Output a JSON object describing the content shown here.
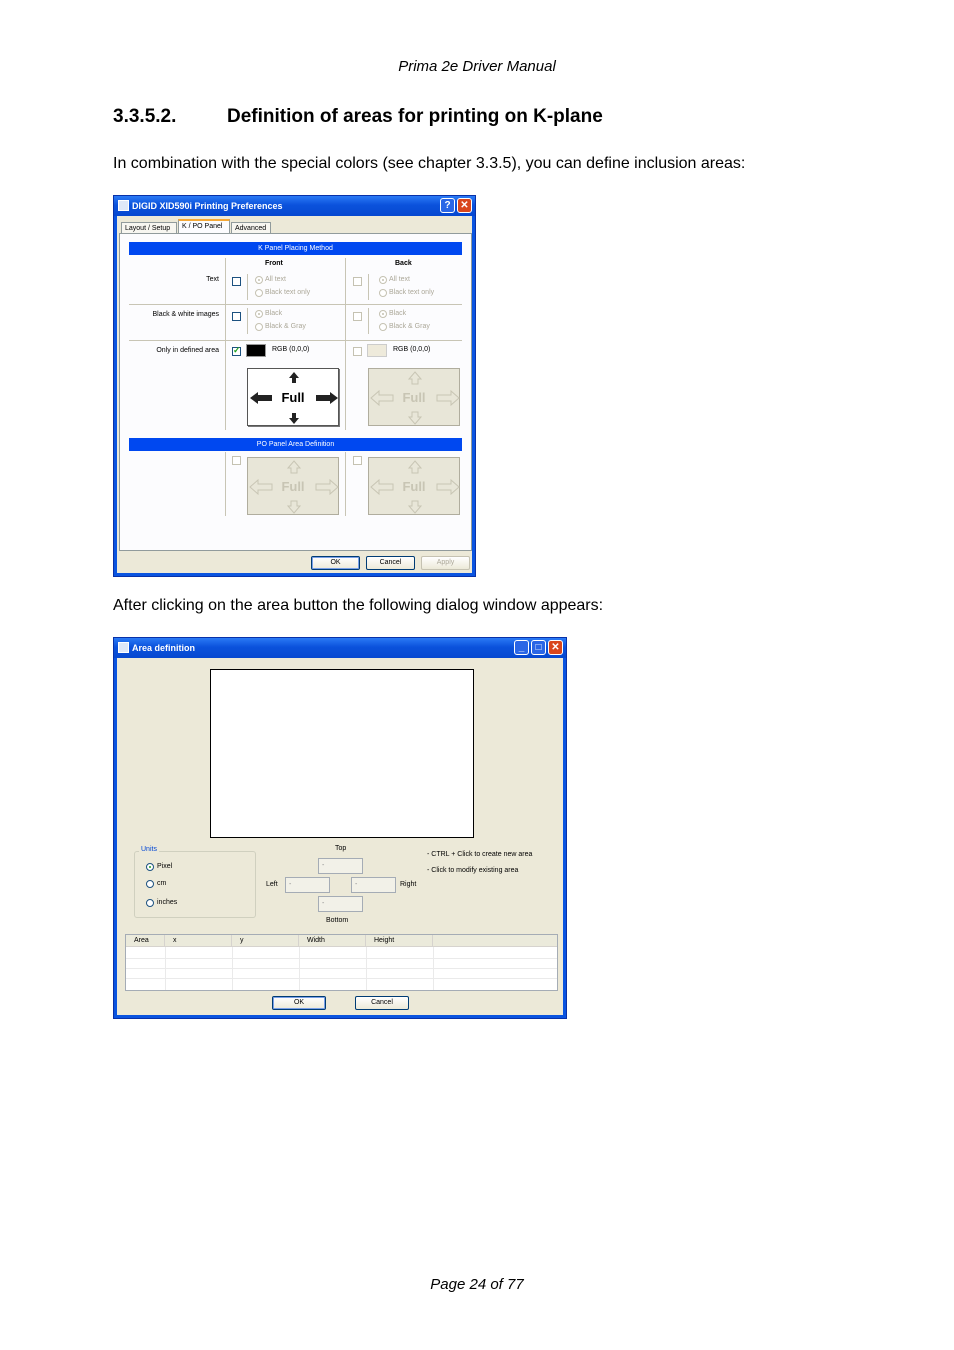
{
  "header": {
    "title": "Prima 2e Driver Manual"
  },
  "section": {
    "number": "3.3.5.2.",
    "title": "Definition of areas for printing on K-plane"
  },
  "intro": "In combination with the special colors (see chapter 3.3.5), you can define inclusion areas:",
  "between": "After clicking on the area button the following dialog window appears:",
  "footer": {
    "page": "Page 24 of 77"
  },
  "prefs": {
    "title": "DIGID XID590i Printing Preferences",
    "help": "?",
    "close": "✕",
    "tabs": [
      "Layout / Setup",
      "K / PO Panel",
      "Advanced"
    ],
    "k_panel_header": "K Panel Placing Method",
    "front": "Front",
    "back": "Back",
    "rows": {
      "text": "Text",
      "bw_images": "Black & white images",
      "defined_area": "Only in defined area"
    },
    "all_text": "All text",
    "black_text_only": "Black text only",
    "black": "Black",
    "black_gray": "Black & Gray",
    "rgb": "RGB (0,0,0)",
    "full": "Full",
    "po_header": "PO Panel Area Definition",
    "ok": "OK",
    "cancel": "Cancel",
    "apply": "Apply"
  },
  "area": {
    "title": "Area definition",
    "minimize": "_",
    "maximize": "□",
    "close": "✕",
    "units_label": "Units",
    "units": [
      "Pixel",
      "cm",
      "inches"
    ],
    "top": "Top",
    "left": "Left",
    "right": "Right",
    "bottom": "Bottom",
    "field_value": "-",
    "hint1": "- CTRL + Click to create new area",
    "hint2": "- Click to modify existing area",
    "columns": [
      "Area",
      "x",
      "y",
      "Width",
      "Height"
    ],
    "ok": "OK",
    "cancel": "Cancel"
  },
  "colors": {
    "titlebar": "#0b52dc",
    "section_header": "#0048f0",
    "dialog_bg": "#ece9d8"
  }
}
